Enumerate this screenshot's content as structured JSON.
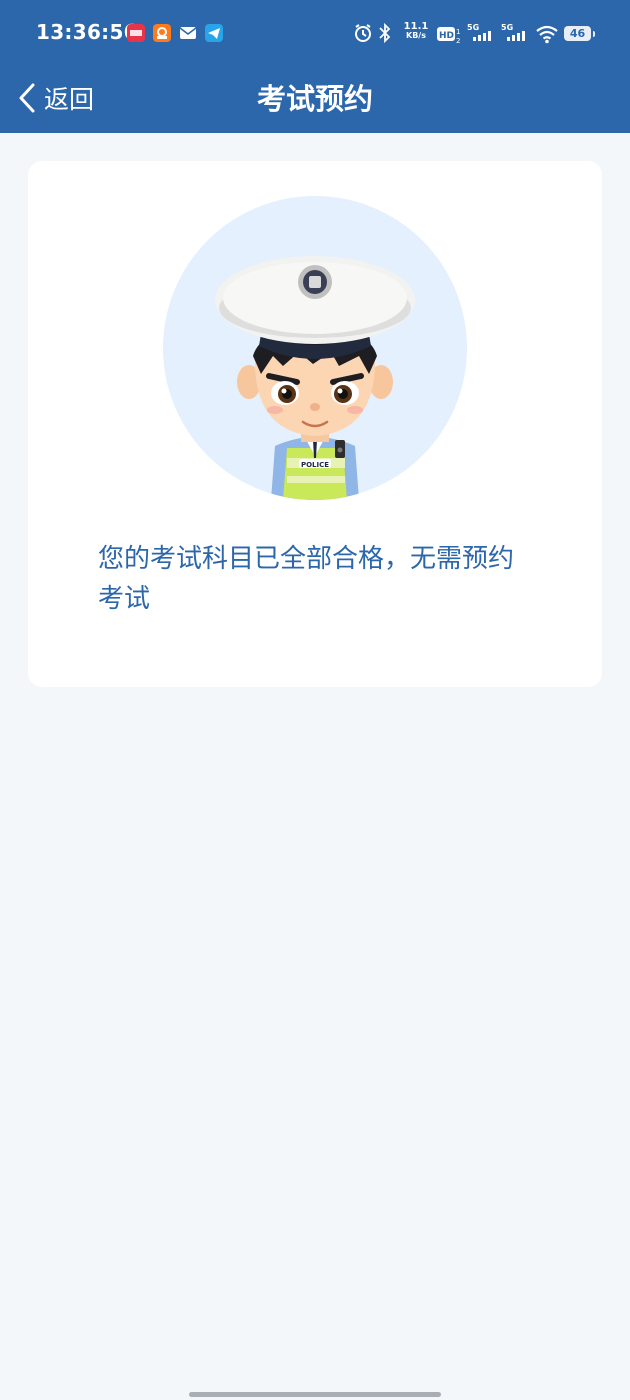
{
  "status_bar": {
    "time": "13:36:56",
    "net_speed": "11.1",
    "net_speed_unit": "KB/s",
    "battery": "46",
    "icons": [
      "app-notification-icon",
      "shopping-app-icon",
      "mail-icon",
      "telegram-icon",
      "alarm-icon",
      "bluetooth-icon",
      "hd-icon",
      "5g-signal-icon",
      "5g-signal-icon",
      "wifi-icon",
      "battery-icon"
    ]
  },
  "nav": {
    "back_label": "返回",
    "title": "考试预约"
  },
  "card": {
    "avatar_icon": "police-officer-avatar",
    "avatar_badge": "POLICE",
    "message": "您的考试科目已全部合格，无需预约考试"
  },
  "colors": {
    "primary": "#2c67ab",
    "background": "#f4f7f9",
    "card": "#ffffff",
    "avatar_bg": "#e4f0fd"
  }
}
